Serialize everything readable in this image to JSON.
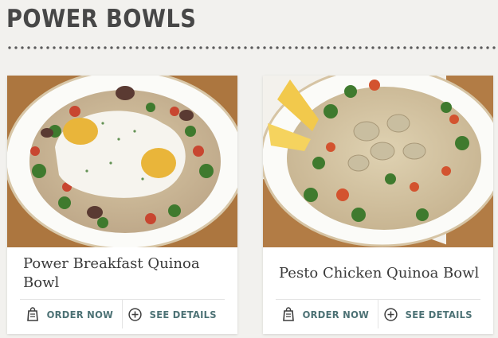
{
  "section": {
    "title": "POWER BOWLS"
  },
  "cards": [
    {
      "title": "Power Breakfast Quinoa Bowl",
      "image_alt": "Power Breakfast Quinoa Bowl",
      "actions": {
        "order": "ORDER NOW",
        "details": "SEE DETAILS"
      }
    },
    {
      "title": "Pesto Chicken Quinoa Bowl",
      "image_alt": "Pesto Chicken Quinoa Bowl",
      "actions": {
        "order": "ORDER NOW",
        "details": "SEE DETAILS"
      }
    }
  ],
  "icons": {
    "order": "order-bag-icon",
    "details": "plus-circle-icon"
  },
  "colors": {
    "accent": "#4d7275",
    "title": "#474747",
    "background": "#f2f1ee"
  }
}
